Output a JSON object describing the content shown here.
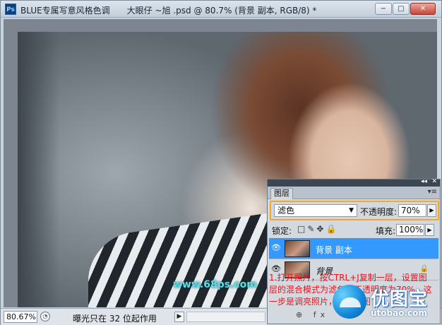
{
  "app": {
    "icon_text": "Ps",
    "title": "BLUE专属写意风格色调　　大眼仔 ~旭 .psd @ 80.7% (背景 副本, RGB/8) *"
  },
  "window_controls": {
    "minimize": "−",
    "maximize": "□",
    "close": "✕"
  },
  "canvas": {
    "watermark": "www.68ps.com"
  },
  "status": {
    "zoom": "80.67%",
    "text": "曝光只在 32 位起作用",
    "arrow": "▶"
  },
  "layers_panel": {
    "tab": "图层",
    "blend_mode": "滤色",
    "opacity_label": "不透明度:",
    "opacity_value": "70%",
    "lock_label": "锁定:",
    "lock_icons": "□✎✥🔒",
    "fill_label": "填充:",
    "fill_value": "100%",
    "layers": [
      {
        "name": "背景 副本",
        "selected": true
      },
      {
        "name": "背景",
        "selected": false,
        "locked": true
      }
    ],
    "footer_icons": "⊕ fx"
  },
  "annotation": "1.打开照片，按CTRL+J复制一层，设置图层的混合模式为滤色，不透明度为70%，这一步是调亮照片，效果如图",
  "brand": {
    "name": "优图宝",
    "url": "utobao.com"
  }
}
